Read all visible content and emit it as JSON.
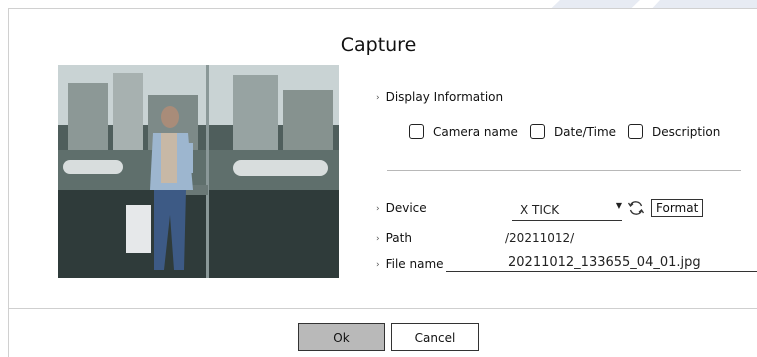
{
  "dialog": {
    "title": "Capture"
  },
  "display_information": {
    "label": "Display Information",
    "options": [
      {
        "label": "Camera name",
        "checked": false
      },
      {
        "label": "Date/Time",
        "checked": false
      },
      {
        "label": "Description",
        "checked": false
      }
    ]
  },
  "device": {
    "label": "Device",
    "value": "X TICK",
    "refresh_icon": "refresh-icon",
    "format_label": "Format"
  },
  "path": {
    "label": "Path",
    "value": "/20211012/"
  },
  "file_name": {
    "label": "File name",
    "value": "20211012_133655_04_01.jpg"
  },
  "footer": {
    "ok_label": "Ok",
    "cancel_label": "Cancel"
  },
  "watermark": {
    "text": "SAM"
  },
  "colors": {
    "ok_button_bg": "#b9b9b9",
    "watermark": "#e4e8f1"
  }
}
